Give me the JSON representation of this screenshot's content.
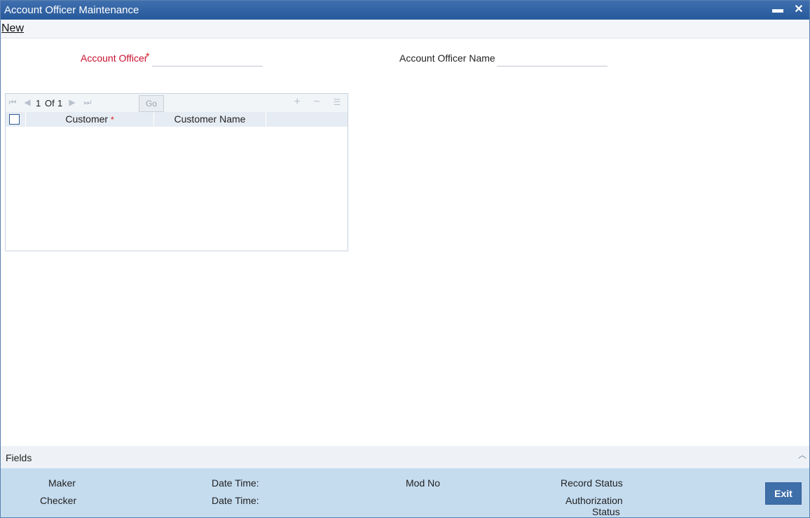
{
  "window": {
    "title": "Account Officer Maintenance",
    "minimize_label": "▬",
    "close_label": "✕"
  },
  "menubar": {
    "new_label": "New"
  },
  "form": {
    "account_officer_label": "Account Officer",
    "required_mark": "*",
    "account_officer_value": "",
    "account_officer_name_label": "Account Officer Name",
    "account_officer_name_value": ""
  },
  "grid": {
    "pager": {
      "current": "1",
      "of_label": "Of",
      "total": "1",
      "goto_value": "",
      "go_label": "Go"
    },
    "icons": {
      "first": "first-page-icon",
      "prev": "prev-page-icon",
      "next": "next-page-icon",
      "last": "last-page-icon",
      "add": "plus-icon",
      "remove": "minus-icon",
      "view": "list-view-icon"
    },
    "columns": [
      {
        "label": "Customer",
        "required": "*"
      },
      {
        "label": "Customer Name"
      }
    ],
    "rows": []
  },
  "footer": {
    "fields_label": "Fields",
    "maker_label": "Maker",
    "checker_label": "Checker",
    "date_time_label": "Date Time:",
    "mod_no_label": "Mod No",
    "record_status_label": "Record Status",
    "authorization_label": "Authorization",
    "status_label": "Status",
    "exit_label": "Exit"
  },
  "colors": {
    "titlebar": "#26599b",
    "required": "#d11111",
    "audit_bg": "#c5dcef",
    "exit_btn": "#3f6fa9"
  }
}
